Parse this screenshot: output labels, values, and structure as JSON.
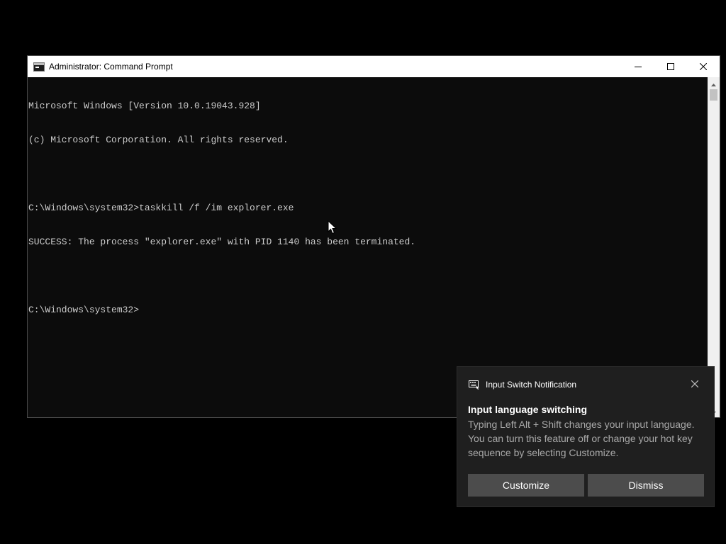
{
  "window": {
    "title": "Administrator: Command Prompt",
    "icon": "cmd-icon",
    "controls": [
      "minimize-icon",
      "maximize-icon",
      "close-icon"
    ]
  },
  "console": {
    "lines": [
      "Microsoft Windows [Version 10.0.19043.928]",
      "(c) Microsoft Corporation. All rights reserved.",
      "",
      "C:\\Windows\\system32>taskkill /f /im explorer.exe",
      "SUCCESS: The process \"explorer.exe\" with PID 1140 has been terminated.",
      "",
      "C:\\Windows\\system32>"
    ]
  },
  "notification": {
    "app_name": "Input Switch Notification",
    "icon": "keyboard-icon",
    "title": "Input language switching",
    "body": "Typing Left Alt + Shift changes your input language. You can turn this feature off or change your hot key sequence by selecting Customize.",
    "buttons": {
      "customize": "Customize",
      "dismiss": "Dismiss"
    }
  },
  "colors": {
    "desktop_background": "#000000",
    "console_background": "#0c0c0c",
    "console_text": "#cccccc",
    "toast_background": "#1f1f1f",
    "toast_button": "#4c4c4c"
  }
}
